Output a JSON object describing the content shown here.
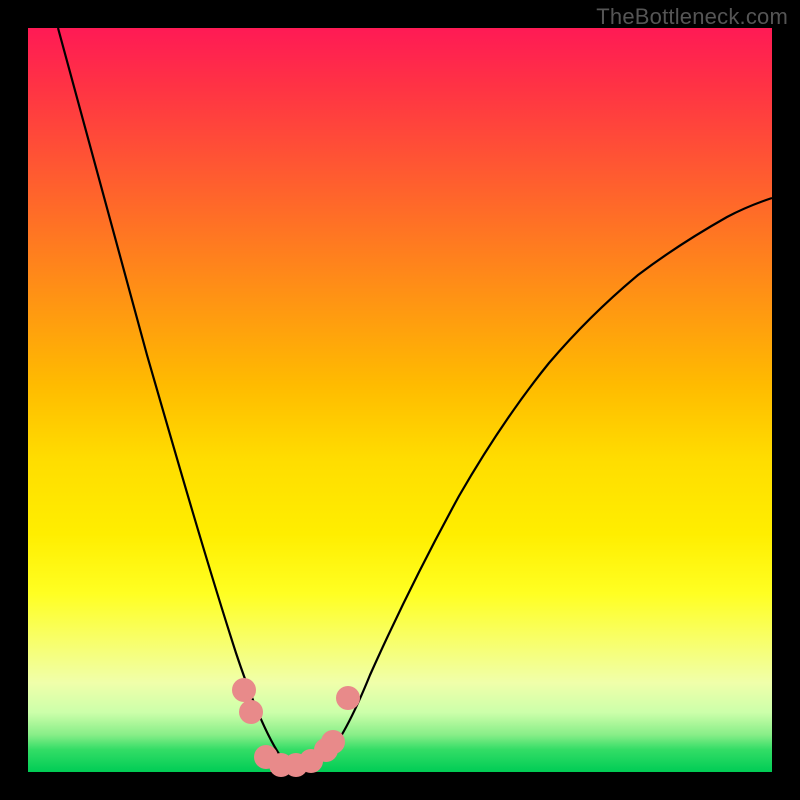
{
  "watermark": "TheBottleneck.com",
  "chart_data": {
    "type": "line",
    "title": "",
    "xlabel": "",
    "ylabel": "",
    "xlim": [
      0,
      100
    ],
    "ylim": [
      0,
      100
    ],
    "grid": false,
    "legend": false,
    "series": [
      {
        "name": "bottleneck-curve",
        "x": [
          4,
          8,
          12,
          16,
          20,
          24,
          28,
          30,
          32,
          34,
          36,
          38,
          40,
          44,
          50,
          56,
          62,
          68,
          74,
          80,
          86,
          92,
          100
        ],
        "y": [
          100,
          85,
          70,
          56,
          42,
          28,
          16,
          10,
          4,
          1,
          0,
          1,
          3,
          8,
          18,
          28,
          37,
          46,
          53,
          60,
          66,
          71,
          77
        ]
      }
    ],
    "markers": [
      {
        "x": 29,
        "y": 11
      },
      {
        "x": 30,
        "y": 8
      },
      {
        "x": 32,
        "y": 2
      },
      {
        "x": 34,
        "y": 1
      },
      {
        "x": 36,
        "y": 1
      },
      {
        "x": 38,
        "y": 1.5
      },
      {
        "x": 40,
        "y": 3
      },
      {
        "x": 41,
        "y": 4
      },
      {
        "x": 43,
        "y": 10
      }
    ],
    "background_gradient": {
      "top": "#ff1a55",
      "middle": "#ffee00",
      "bottom": "#00cc55"
    }
  }
}
